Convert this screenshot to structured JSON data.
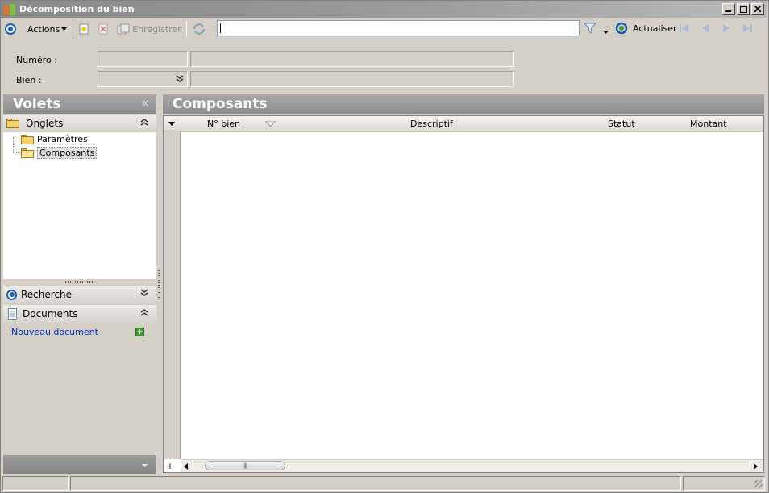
{
  "window": {
    "title": "Décomposition du bien"
  },
  "toolbar": {
    "actions_label": "Actions",
    "save_label": "Enregistrer",
    "search_value": "",
    "refresh_label": "Actualiser"
  },
  "form": {
    "numero_label": "Numéro :",
    "numero_code": "",
    "numero_desc": "",
    "bien_label": "Bien :",
    "bien_code": "",
    "bien_desc": ""
  },
  "left_panel": {
    "title": "Volets",
    "collapse_symbol": "«",
    "groups": {
      "onglets": {
        "label": "Onglets",
        "items": [
          {
            "label": "Paramètres"
          },
          {
            "label": "Composants"
          }
        ]
      },
      "recherche": {
        "label": "Recherche"
      },
      "documents": {
        "label": "Documents",
        "new_document_label": "Nouveau document"
      }
    }
  },
  "main": {
    "title": "Composants",
    "columns": [
      "N° bien",
      "Descriptif",
      "Statut",
      "Montant"
    ],
    "rows": []
  },
  "colors": {
    "header_gray": "#999999",
    "link_blue": "#0033cc",
    "accent_blue": "#1e5fb4"
  },
  "icons": {
    "app": "app-icon",
    "actions": "target-icon",
    "new": "new-record-icon",
    "delete": "delete-icon",
    "save": "save-icon",
    "sync": "sync-icon",
    "filter": "filter-icon",
    "refresh": "refresh-icon",
    "nav_first": "nav-first-icon",
    "nav_prev": "nav-prev-icon",
    "nav_next": "nav-next-icon",
    "nav_last": "nav-last-icon"
  }
}
